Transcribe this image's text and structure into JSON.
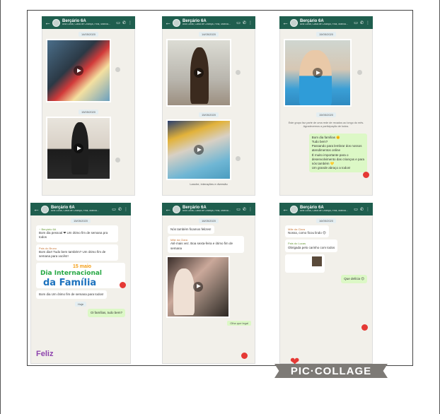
{
  "colors": {
    "header": "#1f5e4e",
    "accent_red": "#e53935",
    "bubble_out": "#dcf8c6"
  },
  "group": {
    "name": "Berçário 6A",
    "subtitle": "Ana Lúcia, Casa de Criança, Fina, Marília..."
  },
  "panels": [
    {
      "date_top": "14/05/2020",
      "date_mid": "15/05/2020"
    },
    {
      "date_top": "14/05/2020",
      "date_mid": "15/05/2020",
      "caption": "Lanche, interações e diversão"
    },
    {
      "date_top": "15/05/2020",
      "date_mid": "15/05/2020",
      "system_note": "Este grupo faz parte de uma rede de recados ao longo do mês. Agradecemos a participação de todos.",
      "message_lines": [
        "Bom dia famílias 🌞",
        "Tudo bem?",
        "Passando para lembrar dos nossos",
        "atendimentos online",
        "É muito importante para o",
        "desenvolvimento das crianças e para",
        "nós também 💛",
        "Um grande abraço a todos!"
      ]
    },
    {
      "date_top": "15/05/2020",
      "msg1_author": "~ Berçário 6A",
      "msg1": "Bom dia pessoal ❤ Um ótimo fim de semana pra todos",
      "msg2_author": "Pais do Bruno",
      "msg2": "Bom dia!! Tudo bem também? Um ótimo fim de semana para vocês!!",
      "card_date": "15 maio",
      "card_l1": "Dia Internacional",
      "card_l2": "da Família",
      "msg3": "Bom dia Um ótimo fim de semana para todos!",
      "date_chip2": "Hoje",
      "msg4": "Oi famílias, tudo bem?",
      "feliz": "Feliz"
    },
    {
      "date_top": "16/05/2020",
      "msg1": "Nós também ficamos felizes!",
      "msg2_author": "Mãe da Clara",
      "msg2": "Até mais vez. Boa sexta-feira e ótimo fim de semana",
      "caption": "Olha que legal"
    },
    {
      "date_top": "16/05/2020",
      "msg1_author": "Mãe da Clara",
      "msg1": "Nossa, como ficou lindo 😍",
      "msg2_author": "Pais do Lucas",
      "msg2": "Obrigada pelo carinho com todos",
      "msg3": "Que delícia 😊",
      "collage_label": "PIC·COLLAGE"
    }
  ]
}
